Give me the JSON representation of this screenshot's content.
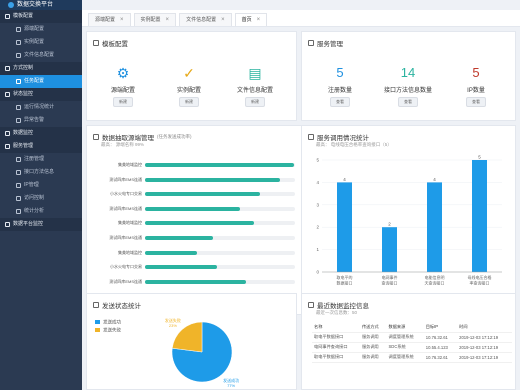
{
  "app": {
    "title": "数据交换平台"
  },
  "sidebar": {
    "items": [
      {
        "label": "模板配置",
        "type": "group"
      },
      {
        "label": "源端配置",
        "type": "item"
      },
      {
        "label": "实例配置",
        "type": "item"
      },
      {
        "label": "文件信息配置",
        "type": "item"
      },
      {
        "label": "方式控制",
        "type": "group"
      },
      {
        "label": "任务配置",
        "type": "item",
        "active": true
      },
      {
        "label": "状态监控",
        "type": "group"
      },
      {
        "label": "运行情况统计",
        "type": "item"
      },
      {
        "label": "异常告警",
        "type": "item"
      },
      {
        "label": "数据监控",
        "type": "group"
      },
      {
        "label": "服务管理",
        "type": "group"
      },
      {
        "label": "注册管理",
        "type": "item"
      },
      {
        "label": "接口方法信息",
        "type": "item"
      },
      {
        "label": "IP管理",
        "type": "item"
      },
      {
        "label": "访问控制",
        "type": "item"
      },
      {
        "label": "统计分析",
        "type": "item"
      },
      {
        "label": "数据平台监控",
        "type": "group"
      }
    ]
  },
  "tabs": [
    {
      "label": "源端配置"
    },
    {
      "label": "实例配置"
    },
    {
      "label": "文件信息配置"
    },
    {
      "label": "首页",
      "active": true
    }
  ],
  "template_config": {
    "title": "模板配置",
    "items": [
      {
        "label": "源端配置",
        "button": "新建",
        "icon": "gear-icon"
      },
      {
        "label": "实例配置",
        "button": "新建",
        "icon": "check-icon"
      },
      {
        "label": "文件信息配置",
        "button": "新建",
        "icon": "document-icon"
      }
    ]
  },
  "service_mgmt": {
    "title": "服务管理",
    "items": [
      {
        "value": "5",
        "label": "注册数量",
        "button": "查看",
        "color": "#1e90e0"
      },
      {
        "value": "14",
        "label": "接口方法信息数量",
        "button": "查看",
        "color": "#2bb3a0"
      },
      {
        "value": "5",
        "label": "IP数量",
        "button": "查看",
        "color": "#c0392b"
      }
    ]
  },
  "source_mgmt": {
    "title": "数据抽取源端管理",
    "title_suffix": "(任务发送成功率)",
    "subtitle": "最高： 源端名称 99%",
    "rows": [
      {
        "label": "集美地域监控",
        "pct": 99,
        "text": "99%"
      },
      {
        "label": "测试四库EMS连通",
        "pct": 90,
        "text": "90%"
      },
      {
        "label": "小水火电专口交易",
        "pct": 76.5,
        "text": "76.5%"
      },
      {
        "label": "测试四库EMS连通",
        "pct": 63.5,
        "text": "63.5%"
      },
      {
        "label": "集美地域监控",
        "pct": 72.75,
        "text": "72.75%"
      },
      {
        "label": "测试四库EMS连通",
        "pct": 45.25,
        "text": "45.25%"
      },
      {
        "label": "集美地域监控",
        "pct": 34.5,
        "text": "34.5%"
      },
      {
        "label": "小水火电专口交易",
        "pct": 47.75,
        "text": "47.75%"
      },
      {
        "label": "测试四库EMS连通",
        "pct": 67.5,
        "text": "67.5%"
      },
      {
        "label": "集美地域监控",
        "pct": 29,
        "text": "29%"
      }
    ]
  },
  "chart_data": [
    {
      "type": "bar",
      "title": "服务调用情况统计",
      "subtitle": "最高： 电线电压合格率查询接口（5）",
      "categories": [
        "取电平的数据接口",
        "电网事件查询接口",
        "电能信息明天查询接口",
        "母线电压合格率查询接口"
      ],
      "values": [
        4,
        2,
        4,
        5
      ],
      "ylim": [
        0,
        5
      ],
      "yticks": [
        0,
        1,
        2,
        3,
        4,
        5
      ],
      "grid": true,
      "color": "#1e9be8"
    },
    {
      "type": "pie",
      "title": "发送状态统计",
      "labels": [
        "发送成功",
        "发送失败"
      ],
      "values": [
        77,
        23
      ],
      "slice_labels": [
        "发送成功\n77%",
        "发送失败\n23%"
      ],
      "colors": [
        "#1e9be8",
        "#f0b429"
      ],
      "legend": "top-left"
    }
  ],
  "latest_monitor": {
    "title": "最近数据监控信息",
    "subtitle": "最近一次信息数：50",
    "columns": [
      "名称",
      "传送方式",
      "数据来源",
      "目标IP",
      "时间"
    ],
    "rows": [
      [
        "取电平数据接口",
        "服务调用",
        "调度管理系统",
        "10.76.32.61",
        "2019-12-03 17:12:19"
      ],
      [
        "电网事件查询接口",
        "服务调用",
        "SDC系统",
        "10.55.4.123",
        "2019-12-03 17:12:19"
      ],
      [
        "取电平数据接口",
        "服务调用",
        "调度管理系统",
        "10.76.32.61",
        "2019-12-03 17:12:19"
      ]
    ]
  }
}
